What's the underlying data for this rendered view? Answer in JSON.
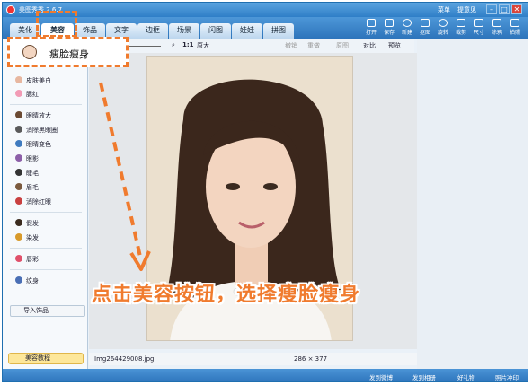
{
  "titlebar": {
    "title": "美图秀秀 2.6.7",
    "menu": "菜单",
    "feedback": "提意见",
    "min": "–",
    "max": "□",
    "close": "✕"
  },
  "tabs": [
    {
      "label": "美化"
    },
    {
      "label": "美容"
    },
    {
      "label": "饰品"
    },
    {
      "label": "文字"
    },
    {
      "label": "边框"
    },
    {
      "label": "场景"
    },
    {
      "label": "闪图"
    },
    {
      "label": "娃娃"
    },
    {
      "label": "拼图"
    }
  ],
  "toolbar": [
    {
      "label": "打开"
    },
    {
      "label": "保存"
    },
    {
      "label": "新建"
    },
    {
      "label": "抠图"
    },
    {
      "label": "旋转"
    },
    {
      "label": "裁剪"
    },
    {
      "label": "尺寸"
    },
    {
      "label": "涂鸦"
    },
    {
      "label": "拍照"
    }
  ],
  "popup": {
    "label": "瘦脸瘦身"
  },
  "leftpanel": {
    "items1": [
      "皮肤美白",
      "腮红"
    ],
    "items2": [
      "眼睛放大",
      "消除黑眼圈",
      "眼睛变色",
      "眼影",
      "睫毛",
      "眉毛",
      "消除红眼"
    ],
    "items3": [
      "假发",
      "染发"
    ],
    "items4": [
      "唇彩"
    ],
    "items5": [
      "纹身"
    ],
    "import": "导入饰品",
    "tutorial": "美容教程"
  },
  "zoom": {
    "ratio": "1:1",
    "enlarge": "原大"
  },
  "edit": {
    "undo": "撤销",
    "redo": "重做",
    "original": "原图",
    "compare": "对比",
    "preview": "预览"
  },
  "status": {
    "filename": "Img264429008.jpg",
    "size": "286 × 377"
  },
  "bottom": {
    "weibo": "发到微博",
    "album": "发到相册",
    "gift": "好礼物",
    "photo": "照片冲印"
  },
  "caption": "点击美容按钮，选择瘦脸瘦身"
}
